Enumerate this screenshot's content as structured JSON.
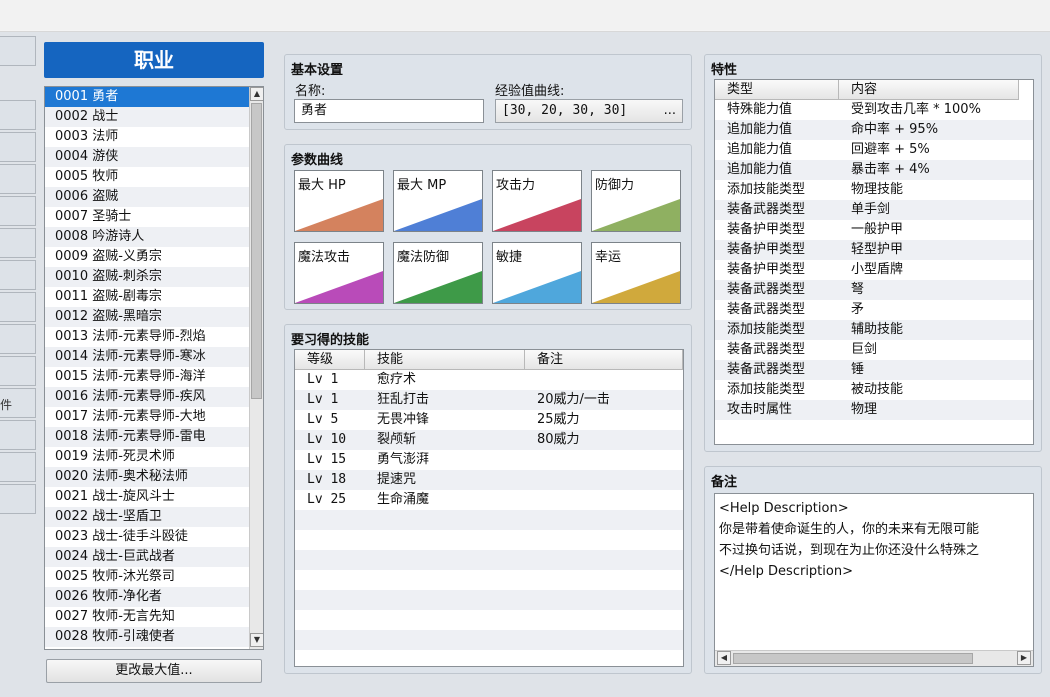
{
  "header": {
    "title": "职业"
  },
  "left_stub_glyph": "件",
  "classes": [
    "0001 勇者",
    "0002 战士",
    "0003 法师",
    "0004 游侠",
    "0005 牧师",
    "0006 盗贼",
    "0007 圣骑士",
    "0008 吟游诗人",
    "0009 盗贼-义勇宗",
    "0010 盗贼-刺杀宗",
    "0011 盗贼-剧毒宗",
    "0012 盗贼-黑暗宗",
    "0013 法师-元素导师-烈焰",
    "0014 法师-元素导师-寒冰",
    "0015 法师-元素导师-海洋",
    "0016 法师-元素导师-疾风",
    "0017 法师-元素导师-大地",
    "0018 法师-元素导师-雷电",
    "0019 法师-死灵术师",
    "0020 法师-奥术秘法师",
    "0021 战士-旋风斗士",
    "0022 战士-坚盾卫",
    "0023 战士-徒手斗殴徒",
    "0024 战士-巨武战者",
    "0025 牧师-沐光祭司",
    "0026 牧师-净化者",
    "0027 牧师-无言先知",
    "0028 牧师-引魂使者"
  ],
  "change_max_button": "更改最大值...",
  "basic": {
    "title": "基本设置",
    "name_label": "名称:",
    "name_value": "勇者",
    "exp_label": "经验值曲线:",
    "exp_value": "[30, 20, 30, 30]",
    "exp_button": "..."
  },
  "params": {
    "title": "参数曲线",
    "items": [
      {
        "label": "最大 HP",
        "color": "#d4825e"
      },
      {
        "label": "最大 MP",
        "color": "#4f7fd6"
      },
      {
        "label": "攻击力",
        "color": "#c8445f"
      },
      {
        "label": "防御力",
        "color": "#8fb061"
      },
      {
        "label": "魔法攻击",
        "color": "#b94bb9"
      },
      {
        "label": "魔法防御",
        "color": "#3e9a48"
      },
      {
        "label": "敏捷",
        "color": "#4fa7dc"
      },
      {
        "label": "幸运",
        "color": "#d0a93c"
      }
    ]
  },
  "skills": {
    "title": "要习得的技能",
    "headers": [
      "等级",
      "技能",
      "备注"
    ],
    "rows": [
      [
        "Lv  1",
        "愈疗术",
        ""
      ],
      [
        "Lv  1",
        "狂乱打击",
        "20威力/一击"
      ],
      [
        "Lv  5",
        "无畏冲锋",
        "25威力"
      ],
      [
        "Lv 10",
        "裂颅斩",
        "80威力"
      ],
      [
        "Lv 15",
        "勇气澎湃",
        ""
      ],
      [
        "Lv 18",
        "提速咒",
        ""
      ],
      [
        "Lv 25",
        "生命涌魔",
        ""
      ]
    ]
  },
  "traits": {
    "title": "特性",
    "headers": [
      "类型",
      "内容"
    ],
    "rows": [
      [
        "特殊能力值",
        "受到攻击几率 * 100%"
      ],
      [
        "追加能力值",
        "命中率 + 95%"
      ],
      [
        "追加能力值",
        "回避率 + 5%"
      ],
      [
        "追加能力值",
        "暴击率 + 4%"
      ],
      [
        "添加技能类型",
        "物理技能"
      ],
      [
        "装备武器类型",
        "单手剑"
      ],
      [
        "装备护甲类型",
        "一般护甲"
      ],
      [
        "装备护甲类型",
        "轻型护甲"
      ],
      [
        "装备护甲类型",
        "小型盾牌"
      ],
      [
        "装备武器类型",
        "弩"
      ],
      [
        "装备武器类型",
        "矛"
      ],
      [
        "添加技能类型",
        "辅助技能"
      ],
      [
        "装备武器类型",
        "巨剑"
      ],
      [
        "装备武器类型",
        "锤"
      ],
      [
        "添加技能类型",
        "被动技能"
      ],
      [
        "攻击时属性",
        "物理"
      ]
    ]
  },
  "note": {
    "title": "备注",
    "lines": [
      "<Help Description>",
      "你是带着使命诞生的人，你的未来有无限可能",
      "不过换句话说，到现在为止你还没什么特殊之",
      "</Help Description>"
    ]
  }
}
